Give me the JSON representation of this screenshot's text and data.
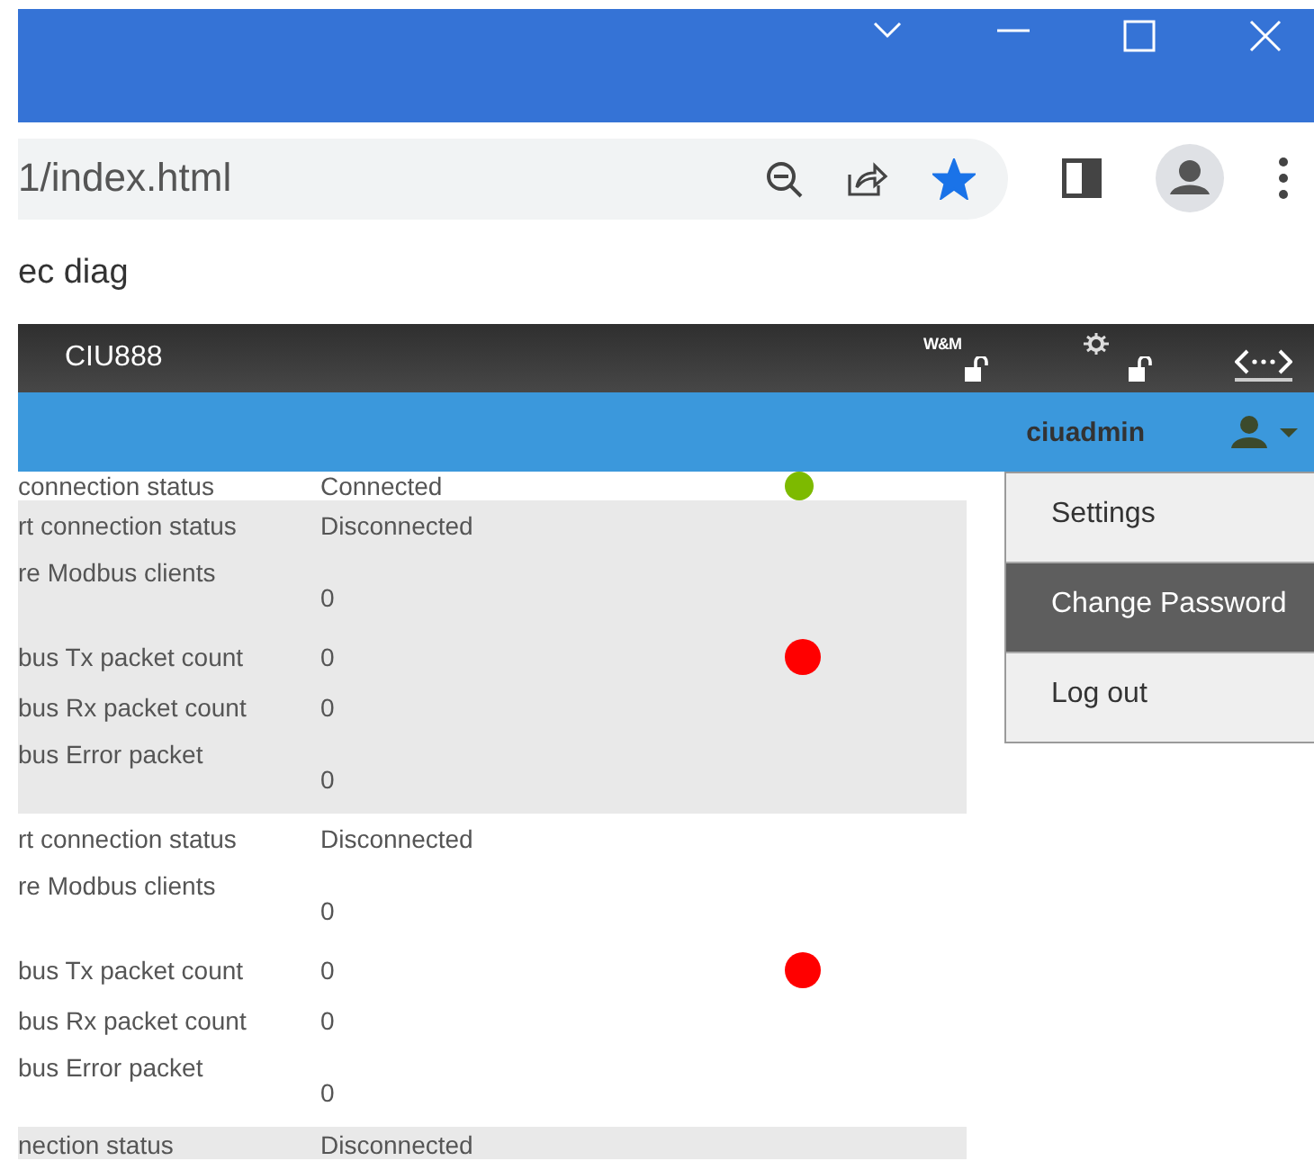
{
  "browser": {
    "address": "1/index.html",
    "bookmarked": true,
    "page_title": "ec diag"
  },
  "app_header": {
    "title": "CIU888",
    "badge": "W&M"
  },
  "user_bar": {
    "username": "ciuadmin"
  },
  "groups": [
    {
      "rows": [
        {
          "kind": "single",
          "label": "connection status",
          "value": "Connected",
          "color": "#7dba00"
        }
      ]
    },
    {
      "rows": [
        {
          "kind": "single",
          "label": "rt connection status",
          "value": "Disconnected"
        },
        {
          "kind": "double",
          "label": "re Modbus clients",
          "value": "0"
        },
        {
          "kind": "single",
          "label": "bus Tx packet count",
          "value": "0",
          "color": "#ff0000"
        },
        {
          "kind": "single",
          "label": "bus Rx packet count",
          "value": "0"
        },
        {
          "kind": "double",
          "label": "bus Error packet",
          "value": "0"
        }
      ]
    },
    {
      "rows": [
        {
          "kind": "single",
          "label": "rt connection status",
          "value": "Disconnected"
        },
        {
          "kind": "double",
          "label": "re Modbus clients",
          "value": "0"
        },
        {
          "kind": "single",
          "label": "bus Tx packet count",
          "value": "0",
          "color": "#ff0000"
        },
        {
          "kind": "single",
          "label": "bus Rx packet count",
          "value": "0"
        },
        {
          "kind": "double",
          "label": "bus Error packet",
          "value": "0"
        }
      ]
    },
    {
      "rows": [
        {
          "kind": "single",
          "label": "nection status",
          "value": "Disconnected"
        }
      ]
    }
  ],
  "user_menu": [
    {
      "label": "Settings",
      "selected": false
    },
    {
      "label": "Change Password",
      "selected": true
    },
    {
      "label": "Log out",
      "selected": false
    }
  ]
}
